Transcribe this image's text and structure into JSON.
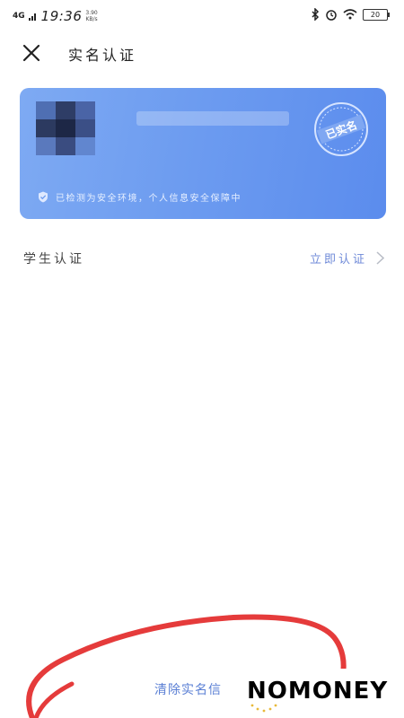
{
  "statusbar": {
    "network": "4G",
    "time": "19:36",
    "speed_value": "3.90",
    "speed_unit": "KB/s",
    "battery": "20"
  },
  "nav": {
    "title": "实名认证"
  },
  "card": {
    "stamp_text": "已实名",
    "secure_message": "已检测为安全环境，个人信息安全保障中",
    "colors": {
      "gradient_start": "#7eaaf3",
      "gradient_end": "#5b8ced"
    }
  },
  "student": {
    "label": "学生认证",
    "action": "立即认证"
  },
  "bottom": {
    "clear_link": "清除实名信"
  },
  "watermark": {
    "logo_text": "NOMONEY"
  },
  "colors": {
    "link": "#5a7fd4",
    "annotation": "#e53b3b"
  }
}
